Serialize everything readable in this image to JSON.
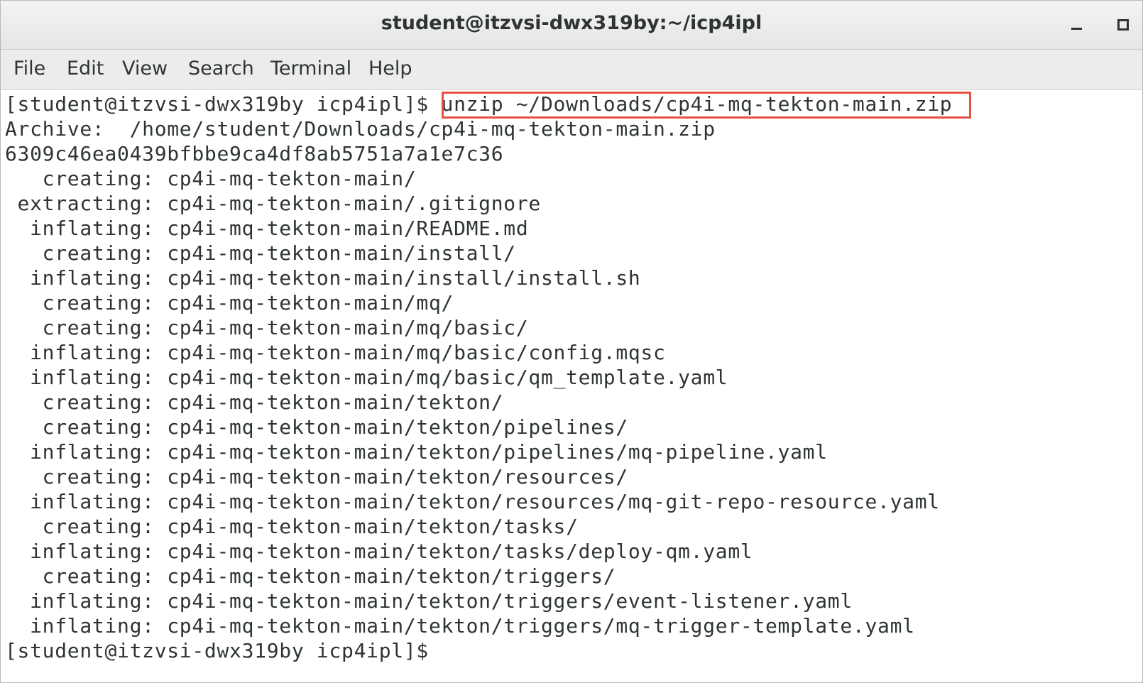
{
  "window": {
    "title": "student@itzvsi-dwx319by:~/icp4ipl"
  },
  "menubar": {
    "items": [
      "File",
      "Edit",
      "View",
      "Search",
      "Terminal",
      "Help"
    ]
  },
  "terminal": {
    "prompt": "[student@itzvsi-dwx319by icp4ipl]$",
    "command": "unzip ~/Downloads/cp4i-mq-tekton-main.zip",
    "output": [
      "Archive:  /home/student/Downloads/cp4i-mq-tekton-main.zip",
      "6309c46ea0439bfbbe9ca4df8ab5751a7a1e7c36",
      "   creating: cp4i-mq-tekton-main/",
      " extracting: cp4i-mq-tekton-main/.gitignore",
      "  inflating: cp4i-mq-tekton-main/README.md",
      "   creating: cp4i-mq-tekton-main/install/",
      "  inflating: cp4i-mq-tekton-main/install/install.sh",
      "   creating: cp4i-mq-tekton-main/mq/",
      "   creating: cp4i-mq-tekton-main/mq/basic/",
      "  inflating: cp4i-mq-tekton-main/mq/basic/config.mqsc",
      "  inflating: cp4i-mq-tekton-main/mq/basic/qm_template.yaml",
      "   creating: cp4i-mq-tekton-main/tekton/",
      "   creating: cp4i-mq-tekton-main/tekton/pipelines/",
      "  inflating: cp4i-mq-tekton-main/tekton/pipelines/mq-pipeline.yaml",
      "   creating: cp4i-mq-tekton-main/tekton/resources/",
      "  inflating: cp4i-mq-tekton-main/tekton/resources/mq-git-repo-resource.yaml",
      "   creating: cp4i-mq-tekton-main/tekton/tasks/",
      "  inflating: cp4i-mq-tekton-main/tekton/tasks/deploy-qm.yaml",
      "   creating: cp4i-mq-tekton-main/tekton/triggers/",
      "  inflating: cp4i-mq-tekton-main/tekton/triggers/event-listener.yaml",
      "  inflating: cp4i-mq-tekton-main/tekton/triggers/mq-trigger-template.yaml"
    ],
    "final_prompt": "[student@itzvsi-dwx319by icp4ipl]$"
  },
  "colors": {
    "highlight_box": "#e8503f",
    "text": "#2e3436"
  }
}
